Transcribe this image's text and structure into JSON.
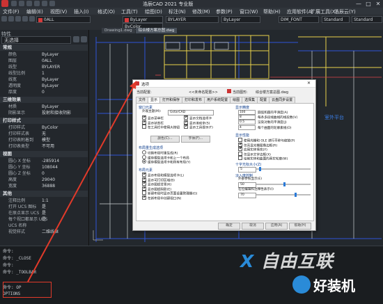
{
  "window": {
    "title": "浩辰CAD 2021 专业版",
    "controls": [
      "—",
      "□",
      "✕"
    ]
  },
  "menu": {
    "items": [
      "文件(F)",
      "编辑(E)",
      "视图(V)",
      "插入(I)",
      "格式(O)",
      "工具(T)",
      "绘图(D)",
      "标注(N)",
      "修改(M)",
      "参数(P)",
      "窗口(W)",
      "帮助(H)",
      "应用软件(A)",
      "扩展工具(X)",
      "浩辰云(Y)"
    ]
  },
  "toolbar": {
    "layer_combo": "0ALL",
    "color_combo": "ByLayer",
    "linetype_combo": "BYLAYER",
    "lineweight_combo": "ByLayer",
    "textstyle_combo": "DIM_FONT",
    "style_combo_1": "Standard",
    "style_combo_2": "Standard",
    "plot_combo": "ByColor"
  },
  "properties": {
    "header": "特性",
    "selection_combo": "无选择",
    "sections": [
      {
        "title": "常规",
        "rows": [
          {
            "k": "颜色",
            "v": "ByLayer"
          },
          {
            "k": "图层",
            "v": "0ALL"
          },
          {
            "k": "线型",
            "v": "BYLAYER"
          },
          {
            "k": "线型比例",
            "v": "1"
          },
          {
            "k": "线宽",
            "v": "ByLayer"
          },
          {
            "k": "透明度",
            "v": "ByLayer"
          },
          {
            "k": "厚度",
            "v": "0"
          }
        ]
      },
      {
        "title": "三维效果",
        "rows": [
          {
            "k": "材质",
            "v": "ByLayer"
          },
          {
            "k": "阴影显示",
            "v": "投射和接收阴影"
          }
        ]
      },
      {
        "title": "打印样式",
        "rows": [
          {
            "k": "打印样式",
            "v": "ByColor"
          },
          {
            "k": "打印样式表",
            "v": "无"
          },
          {
            "k": "打印表附着到",
            "v": "模型"
          },
          {
            "k": "打印表类型",
            "v": "不可用"
          }
        ]
      },
      {
        "title": "视图",
        "rows": [
          {
            "k": "圆心 X 坐标",
            "v": "-285914"
          },
          {
            "k": "圆心 Y 坐标",
            "v": "108044"
          },
          {
            "k": "圆心 Z 坐标",
            "v": "0"
          },
          {
            "k": "高度",
            "v": "29040"
          },
          {
            "k": "宽度",
            "v": "36888"
          }
        ]
      },
      {
        "title": "其他",
        "rows": [
          {
            "k": "注释比例",
            "v": "1:1"
          },
          {
            "k": "打开 UCS 图标",
            "v": "是"
          },
          {
            "k": "在原点显示 UCS",
            "v": "是"
          },
          {
            "k": "每个视口都显示 UCS",
            "v": "是"
          },
          {
            "k": "UCS 名称",
            "v": ""
          },
          {
            "k": "视觉样式",
            "v": "二维线框"
          }
        ]
      }
    ]
  },
  "drawing_tabs": [
    "Drawing1.dwg",
    "综合楼方案总图.dwg"
  ],
  "drawing_labels": {
    "room": "室外平台"
  },
  "command_line": {
    "lines": [
      "命令:",
      "命令: _CLOSE",
      "命令:",
      "命令: _TOOLBAR",
      "命令: OP",
      "OPTIONS"
    ]
  },
  "options_dialog": {
    "title": "选项",
    "current_profile_label": "当前配置:",
    "current_profile_value": "<<未命名配置>>",
    "current_drawing_label": "当前图形:",
    "current_drawing_value": "综合楼方案总图.dwg",
    "tabs": [
      "文件",
      "显示",
      "打开和保存",
      "打印和发布",
      "用户系统配置",
      "绘图",
      "选择集",
      "配置",
      "云盘同步设置"
    ],
    "active_tab": "显示",
    "window_elements": {
      "title": "窗口元素",
      "scheme_label": "外观主题(M):",
      "scheme_value": "GstarCAD",
      "checks": [
        {
          "label": "显示菜单栏",
          "on": true
        },
        {
          "label": "显示文档选项卡",
          "on": true
        },
        {
          "label": "显示状态栏",
          "on": true
        },
        {
          "label": "显示滚动条(S)",
          "on": true
        },
        {
          "label": "在工具栏中使用大按钮",
          "on": false
        },
        {
          "label": "显示工具提示(T)",
          "on": true
        }
      ],
      "color_button": "颜色(C)...",
      "font_button": "字体(F)..."
    },
    "layout_elements": {
      "title": "布局重生成选项",
      "radios": [
        {
          "label": "切换布局时重生成(R)",
          "on": false
        },
        {
          "label": "缓存模型选项卡和上一个布局",
          "on": false
        },
        {
          "label": "缓存模型选项卡和所有布局(Y)",
          "on": true
        }
      ]
    },
    "layout_items": {
      "title": "布局元素",
      "checks": [
        {
          "label": "显示布局和模型选项卡(L)",
          "on": true
        },
        {
          "label": "显示可打印区域(B)",
          "on": true
        },
        {
          "label": "显示图纸背景(K)",
          "on": true
        },
        {
          "label": "显示图纸阴影(E)",
          "on": true
        },
        {
          "label": "新建布局时显示页面设置管理器(G)",
          "on": false
        },
        {
          "label": "在新布局中创建视口(N)",
          "on": true
        }
      ]
    },
    "display_resolution": {
      "title": "显示精度",
      "rows": [
        {
          "value": "100",
          "label": "圆弧和圆的平滑度(A)"
        },
        {
          "value": "8",
          "label": "每条多段线曲线的线段数(V)"
        },
        {
          "value": "0.5",
          "label": "渲染对象的平滑度(J)"
        },
        {
          "value": "4",
          "label": "每个曲面的轮廓素线(O)"
        }
      ]
    },
    "display_performance": {
      "title": "显示性能",
      "checks": [
        {
          "label": "使用光栅和 OLE 进行平移与缩放(P)",
          "on": false
        },
        {
          "label": "仅亮显光栅图像边框(R)",
          "on": true
        },
        {
          "label": "应用实体填充(Y)",
          "on": true
        },
        {
          "label": "仅显示文字边框(X)",
          "on": false
        },
        {
          "label": "绘制实体和曲面的真实轮廓(W)",
          "on": false
        }
      ]
    },
    "crosshair": {
      "title": "十字光标大小(Z)",
      "value": "5",
      "slider_fraction": 0.05
    },
    "fade_control": {
      "title": "淡入度控制",
      "xref_label": "外部参照显示(E)",
      "xref_value": "50",
      "xref_fraction": 0.5,
      "inplace_label": "在位编辑和注释性表示(I)",
      "inplace_value": "70",
      "inplace_fraction": 0.7
    },
    "buttons": [
      "确定",
      "取消",
      "应用(A)",
      "帮助(H)"
    ]
  },
  "watermark": {
    "brand_1": "自由互联",
    "brand_2": "好装机"
  },
  "accent_colors": {
    "highlight": "#e23a2a",
    "drawing_line": "#e8d24a",
    "drawing_blue": "#2f55d8"
  }
}
